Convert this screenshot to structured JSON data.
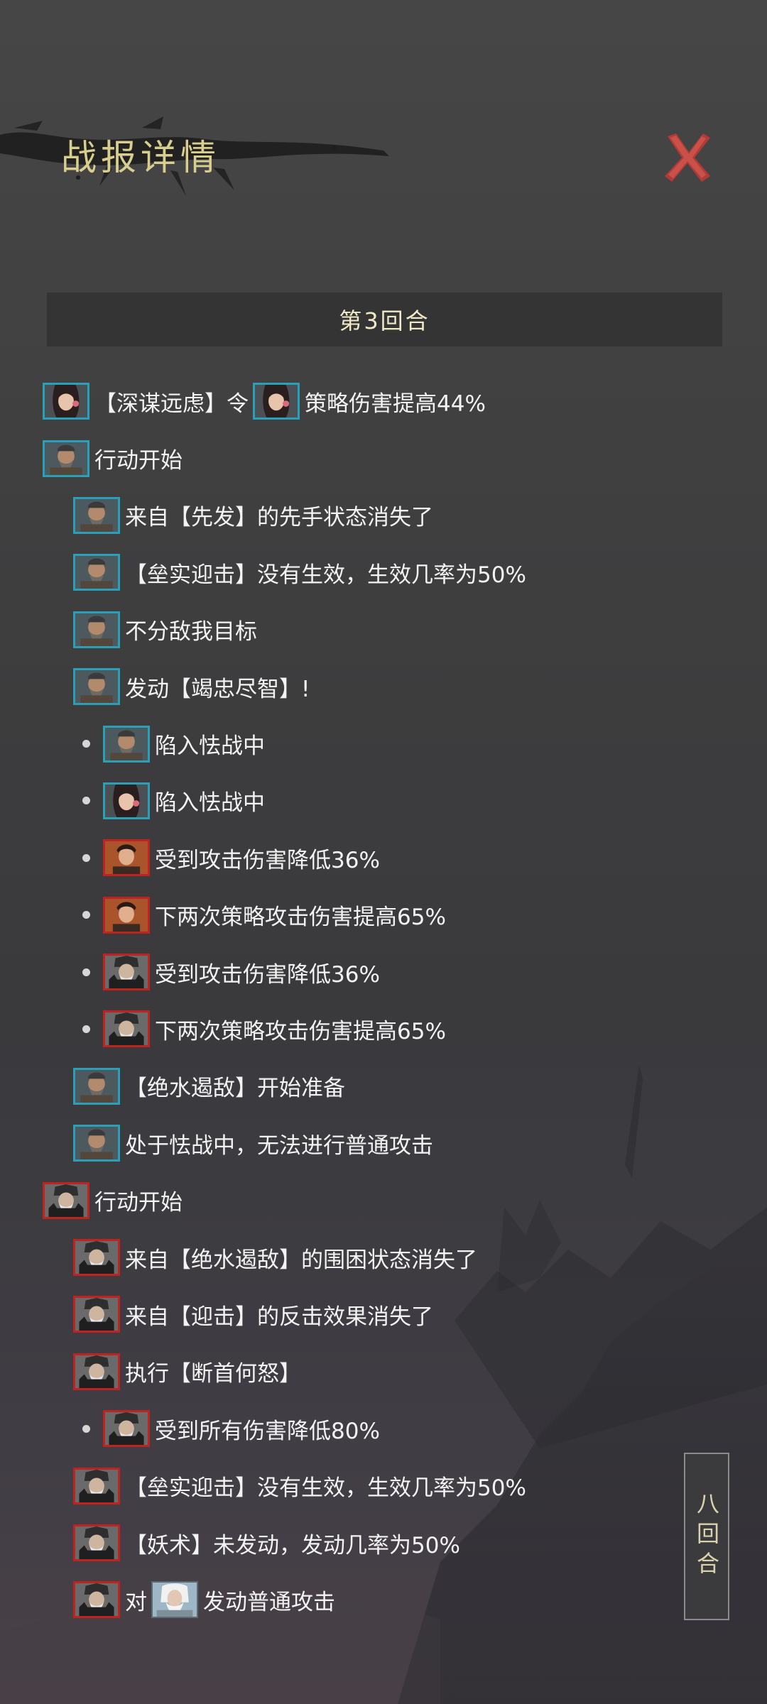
{
  "header": {
    "title": "战报详情",
    "close_icon": "close-icon"
  },
  "round": {
    "label": "第3回合"
  },
  "side_tab": {
    "label": "八回合"
  },
  "colors": {
    "ally_border": "#2aa0b8",
    "enemy_border": "#c0231f",
    "title": "#d8cf8e"
  },
  "log": [
    {
      "indent": 0,
      "bullet": false,
      "avatar": "strategist-woman",
      "side": "ally",
      "text": "【深谋远虑】令",
      "avatar2": "strategist-woman",
      "side2": "ally",
      "text2": "策略伤害提高44%"
    },
    {
      "indent": 0,
      "bullet": false,
      "avatar": "old-general",
      "side": "ally",
      "text": "行动开始"
    },
    {
      "indent": 1,
      "bullet": false,
      "avatar": "old-general",
      "side": "ally",
      "text": "来自【先发】的先手状态消失了"
    },
    {
      "indent": 1,
      "bullet": false,
      "avatar": "old-general",
      "side": "ally",
      "text": "【垒实迎击】没有生效，生效几率为50%"
    },
    {
      "indent": 1,
      "bullet": false,
      "avatar": "old-general",
      "side": "ally",
      "text": "不分敌我目标"
    },
    {
      "indent": 1,
      "bullet": false,
      "avatar": "old-general",
      "side": "ally",
      "text": "发动【竭忠尽智】!"
    },
    {
      "indent": 2,
      "bullet": true,
      "avatar": "old-general",
      "side": "ally",
      "text": "陷入怯战中"
    },
    {
      "indent": 2,
      "bullet": true,
      "avatar": "strategist-woman",
      "side": "ally",
      "text": "陷入怯战中"
    },
    {
      "indent": 2,
      "bullet": true,
      "avatar": "young-warrior",
      "side": "enemy",
      "text": "受到攻击伤害降低36%"
    },
    {
      "indent": 2,
      "bullet": true,
      "avatar": "young-warrior",
      "side": "enemy",
      "text": "下两次策略攻击伤害提高65%"
    },
    {
      "indent": 2,
      "bullet": true,
      "avatar": "armored-general",
      "side": "enemy",
      "text": "受到攻击伤害降低36%"
    },
    {
      "indent": 2,
      "bullet": true,
      "avatar": "armored-general",
      "side": "enemy",
      "text": "下两次策略攻击伤害提高65%"
    },
    {
      "indent": 1,
      "bullet": false,
      "avatar": "old-general",
      "side": "ally",
      "text": "【绝水遏敌】开始准备"
    },
    {
      "indent": 1,
      "bullet": false,
      "avatar": "old-general",
      "side": "ally",
      "text": "处于怯战中，无法进行普通攻击"
    },
    {
      "indent": 0,
      "bullet": false,
      "avatar": "armored-general",
      "side": "enemy",
      "text": "行动开始"
    },
    {
      "indent": 1,
      "bullet": false,
      "avatar": "armored-general",
      "side": "enemy",
      "text": "来自【绝水遏敌】的围困状态消失了"
    },
    {
      "indent": 1,
      "bullet": false,
      "avatar": "armored-general",
      "side": "enemy",
      "text": "来自【迎击】的反击效果消失了"
    },
    {
      "indent": 1,
      "bullet": false,
      "avatar": "armored-general",
      "side": "enemy",
      "text": "执行【断首何怒】"
    },
    {
      "indent": 2,
      "bullet": true,
      "avatar": "armored-general",
      "side": "enemy",
      "text": "受到所有伤害降低80%"
    },
    {
      "indent": 1,
      "bullet": false,
      "avatar": "armored-general",
      "side": "enemy",
      "text": "【垒实迎击】没有生效，生效几率为50%"
    },
    {
      "indent": 1,
      "bullet": false,
      "avatar": "armored-general",
      "side": "enemy",
      "text": "【妖术】未发动，发动几率为50%"
    },
    {
      "indent": 1,
      "bullet": false,
      "avatar": "armored-general",
      "side": "enemy",
      "text": "对",
      "avatar2": "white-haired-elder",
      "side2": "neutral",
      "text2": "发动普通攻击"
    }
  ]
}
